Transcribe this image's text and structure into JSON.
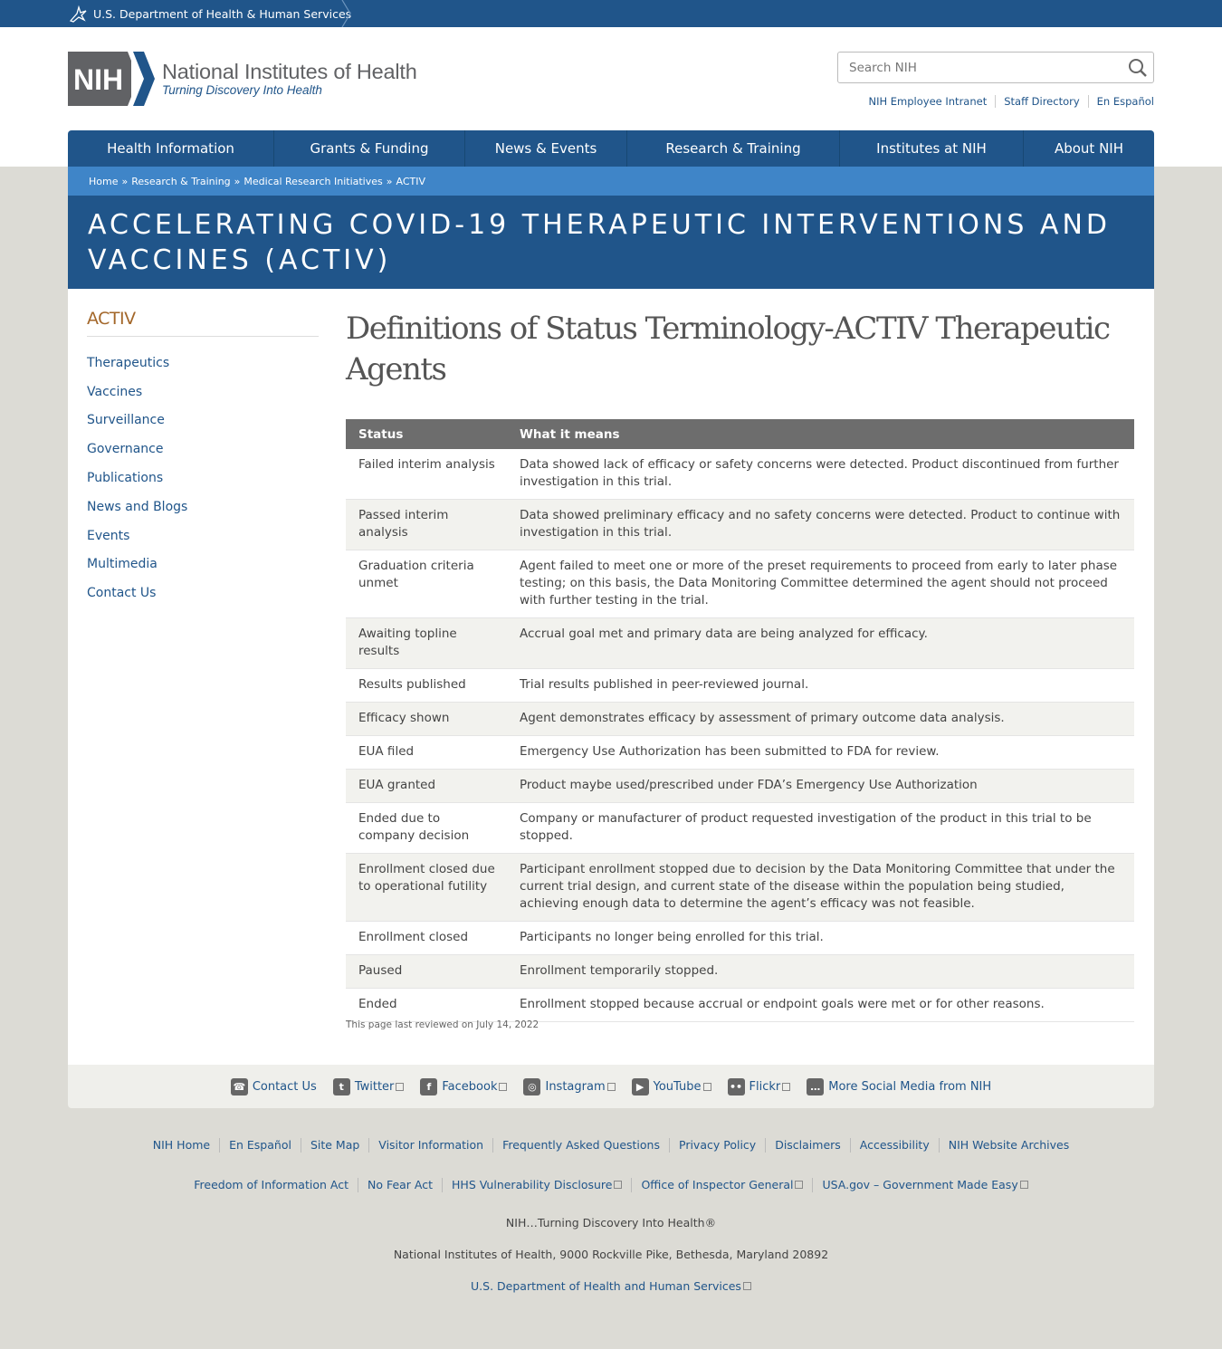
{
  "hhs_bar": {
    "label": "U.S. Department of Health & Human Services"
  },
  "header": {
    "logo_abbrev": "NIH",
    "logo_title": "National Institutes of Health",
    "logo_tagline": "Turning Discovery Into Health",
    "search_placeholder": "Search NIH",
    "utility_links": [
      "NIH Employee Intranet",
      "Staff Directory",
      "En Español"
    ]
  },
  "nav": [
    "Health Information",
    "Grants & Funding",
    "News & Events",
    "Research & Training",
    "Institutes at NIH",
    "About NIH"
  ],
  "breadcrumb": [
    "Home",
    "Research & Training",
    "Medical Research Initiatives",
    "ACTIV"
  ],
  "banner_title": "ACCELERATING COVID-19 THERAPEUTIC INTERVENTIONS AND VACCINES (ACTIV)",
  "sidebar": {
    "title": "ACTIV",
    "items": [
      "Therapeutics",
      "Vaccines",
      "Surveillance",
      "Governance",
      "Publications",
      "News and Blogs",
      "Events",
      "Multimedia",
      "Contact Us"
    ]
  },
  "main": {
    "heading": "Definitions of Status Terminology-ACTIV Therapeutic Agents",
    "table": {
      "headers": [
        "Status",
        "What it means"
      ],
      "rows": [
        [
          "Failed interim analysis",
          "Data showed lack of efficacy or safety concerns were detected. Product discontinued from further investigation in this trial."
        ],
        [
          "Passed interim analysis",
          "Data showed preliminary efficacy and no safety concerns were detected. Product to continue with investigation in this trial."
        ],
        [
          "Graduation criteria unmet",
          "Agent failed to meet one or more of the preset requirements to proceed from early to later phase testing; on this basis, the Data Monitoring Committee determined the agent should not proceed with further testing in the trial."
        ],
        [
          "Awaiting topline results",
          "Accrual goal met and primary data are being analyzed for efficacy."
        ],
        [
          "Results published",
          "Trial results published in peer-reviewed journal."
        ],
        [
          "Efficacy shown",
          "Agent demonstrates efficacy by assessment of primary outcome data analysis."
        ],
        [
          "EUA filed",
          "Emergency Use Authorization has been submitted to FDA for review."
        ],
        [
          "EUA granted",
          "Product maybe used/prescribed under FDA’s Emergency Use Authorization"
        ],
        [
          "Ended due to company decision",
          "Company or manufacturer of product requested investigation of the product in this trial to be stopped."
        ],
        [
          "Enrollment closed due to operational futility",
          "Participant enrollment stopped due to decision by the Data Monitoring Committee that under the current trial design, and current state of the disease within the population being studied, achieving enough data to determine the agent’s efficacy was not feasible."
        ],
        [
          "Enrollment closed",
          "Participants no longer being enrolled for this trial."
        ],
        [
          "Paused",
          "Enrollment temporarily stopped."
        ],
        [
          "Ended",
          "Enrollment stopped because accrual or endpoint goals were met or for other reasons."
        ]
      ]
    },
    "last_reviewed": "This page last reviewed on July 14, 2022"
  },
  "social": [
    {
      "label": "Contact Us",
      "icon": "phone-icon",
      "external": false
    },
    {
      "label": "Twitter",
      "icon": "twitter-icon",
      "external": true
    },
    {
      "label": "Facebook",
      "icon": "facebook-icon",
      "external": true
    },
    {
      "label": "Instagram",
      "icon": "instagram-icon",
      "external": true
    },
    {
      "label": "YouTube",
      "icon": "youtube-icon",
      "external": true
    },
    {
      "label": "Flickr",
      "icon": "flickr-icon",
      "external": true
    },
    {
      "label": "More Social Media from NIH",
      "icon": "chat-icon",
      "external": false
    }
  ],
  "footer": {
    "links_row1": [
      "NIH Home",
      "En Español",
      "Site Map",
      "Visitor Information",
      "Frequently Asked Questions",
      "Privacy Policy",
      "Disclaimers",
      "Accessibility",
      "NIH Website Archives"
    ],
    "links_row2": [
      "Freedom of Information Act",
      "No Fear Act",
      "HHS Vulnerability Disclosure",
      "Office of Inspector General",
      "USA.gov – Government Made Easy"
    ],
    "tagline": "NIH…Turning Discovery Into Health®",
    "address": "National Institutes of Health, 9000 Rockville Pike, Bethesda, Maryland 20892",
    "hhs_link": "U.S. Department of Health and Human Services"
  },
  "colors": {
    "primary": "#20558a",
    "breadcrumb": "#3f85c8",
    "table_header": "#6d6d6d",
    "sidebar_title": "#a3672a"
  }
}
